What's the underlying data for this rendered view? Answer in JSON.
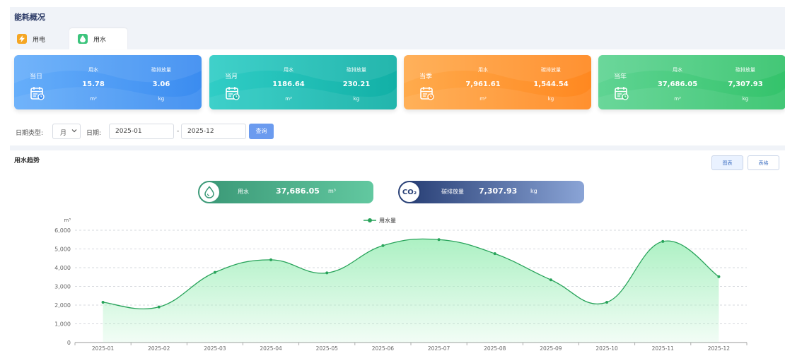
{
  "page_title": "能耗概况",
  "tabs": [
    {
      "label": "用电",
      "icon": "lightning-icon",
      "color": "#f5a623",
      "active": false
    },
    {
      "label": "用水",
      "icon": "water-drop-icon",
      "color": "#3cc47c",
      "active": true
    }
  ],
  "cards": [
    {
      "period": "当日",
      "metric_label": "用水",
      "metric_value": "15.78",
      "metric_unit": "m³",
      "carbon_label": "碳排放量",
      "carbon_value": "3.06",
      "carbon_unit": "kg",
      "color_from": "#5aa6f8",
      "color_to": "#3d8ef0"
    },
    {
      "period": "当月",
      "metric_label": "用水",
      "metric_value": "1186.64",
      "metric_unit": "m³",
      "carbon_label": "碳排放量",
      "carbon_value": "230.21",
      "carbon_unit": "kg",
      "color_from": "#2fcbc4",
      "color_to": "#15b3a9"
    },
    {
      "period": "当季",
      "metric_label": "用水",
      "metric_value": "7,961.61",
      "metric_unit": "m³",
      "carbon_label": "碳排放量",
      "carbon_value": "1,544.54",
      "carbon_unit": "kg",
      "color_from": "#ffa94a",
      "color_to": "#ff8a20"
    },
    {
      "period": "当年",
      "metric_label": "用水",
      "metric_value": "37,686.05",
      "metric_unit": "m³",
      "carbon_label": "碳排放量",
      "carbon_value": "7,307.93",
      "carbon_unit": "kg",
      "color_from": "#58d18c",
      "color_to": "#36c26e"
    }
  ],
  "filters": {
    "date_type_label": "日期类型:",
    "date_type_value": "月",
    "date_label": "日期:",
    "start_date": "2025-01",
    "separator": "-",
    "end_date": "2025-12",
    "query_button": "查询"
  },
  "section_title": "用水趋势",
  "view_toggle": {
    "chart": "图表",
    "table": "表格"
  },
  "summary": {
    "water_label": "用水",
    "water_value": "37,686.05",
    "water_unit": "m³",
    "carbon_icon_text": "CO₂",
    "carbon_label": "碳排放量",
    "carbon_value": "7,307.93",
    "carbon_unit": "kg"
  },
  "chart_data": {
    "type": "area",
    "x": [
      "2025-01",
      "2025-02",
      "2025-03",
      "2025-04",
      "2025-05",
      "2025-06",
      "2025-07",
      "2025-08",
      "2025-09",
      "2025-10",
      "2025-11",
      "2025-12"
    ],
    "series": [
      {
        "name": "用水量",
        "values": [
          2150,
          1900,
          3750,
          4420,
          3720,
          5180,
          5500,
          4750,
          3350,
          2150,
          5400,
          3520
        ],
        "color": "#28a35a",
        "fill": "#a8f0c0"
      }
    ],
    "ylabel": "m³",
    "ylim": [
      0,
      6000
    ],
    "yticks": [
      "0",
      "1,000",
      "2,000",
      "3,000",
      "4,000",
      "5,000",
      "6,000"
    ],
    "grid": true,
    "legend": "top-center"
  }
}
